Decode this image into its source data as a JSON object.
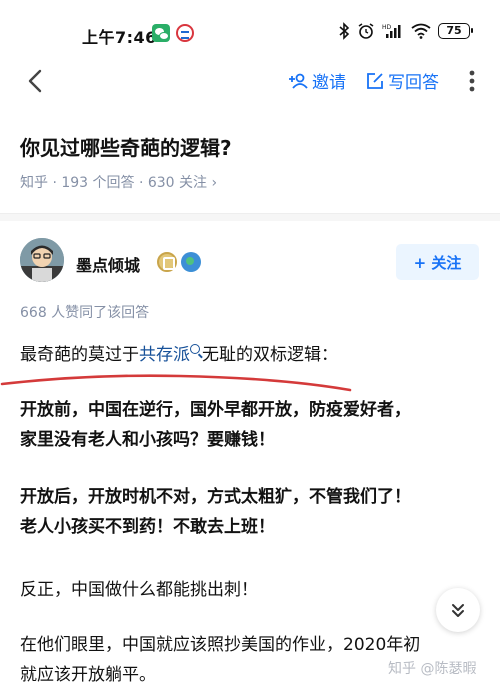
{
  "status_bar": {
    "time": "上午7:46",
    "battery": "75",
    "icons": [
      "wechat-icon",
      "app-icon",
      "bluetooth-icon",
      "alarm-icon",
      "hd-signal-icon",
      "wifi-icon",
      "battery-icon"
    ]
  },
  "nav": {
    "invite_label": "邀请",
    "write_answer_label": "写回答"
  },
  "question": {
    "title": "你见过哪些奇葩的逻辑?",
    "meta": "知乎 · 193 个回答 · 630 关注 ›"
  },
  "author": {
    "name": "墨点倾城",
    "follow_label": "+ 关注"
  },
  "answer": {
    "upvotes": "668 人赞同了该回答",
    "intro_before": "最奇葩的莫过于",
    "intro_link": "共存派",
    "intro_after": "无耻的双标逻辑：",
    "p1_line1": "开放前，中国在逆行，国外早都开放，防疫爱好者，",
    "p1_line2": "家里没有老人和小孩吗？要赚钱！",
    "p2_line1": "开放后，开放时机不对，方式太粗犷，不管我们了！",
    "p2_line2": "老人小孩买不到药！不敢去上班！",
    "p3": "反正，中国做什么都能挑出刺！",
    "p4_line1": "在他们眼里，中国就应该照抄美国的作业，2020年初",
    "p4_line2": "就应该开放躺平。"
  },
  "watermark": "知乎 @陈瑟暇",
  "colors": {
    "accent": "#1772f6",
    "meta_gray": "#8590a6",
    "link": "#175199",
    "annotation_red": "#d43a3a"
  }
}
